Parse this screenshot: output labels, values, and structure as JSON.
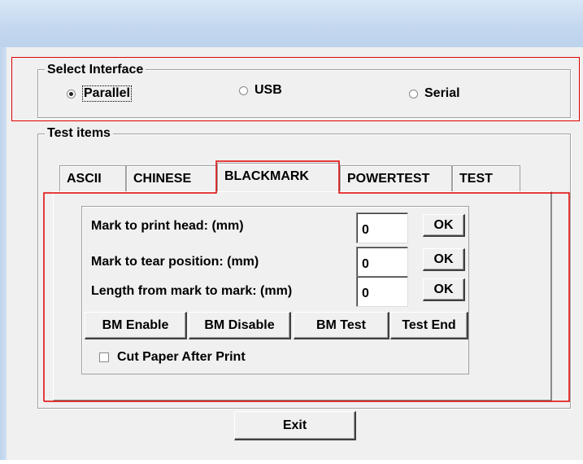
{
  "interface_group": {
    "legend": "Select Interface",
    "options": [
      {
        "label": "Parallel",
        "selected": true
      },
      {
        "label": "USB",
        "selected": false
      },
      {
        "label": "Serial",
        "selected": false
      }
    ]
  },
  "test_group": {
    "legend": "Test items",
    "tabs": [
      "ASCII",
      "CHINESE",
      "BLACKMARK",
      "POWERTEST",
      "TEST"
    ],
    "active_tab": "BLACKMARK"
  },
  "blackmark": {
    "rows": [
      {
        "label": "Mark to print head: (mm)",
        "value": "0",
        "ok": "OK"
      },
      {
        "label": "Mark to tear position: (mm)",
        "value": "0",
        "ok": "OK"
      },
      {
        "label": "Length from mark to mark: (mm)",
        "value": "0",
        "ok": "OK"
      }
    ],
    "buttons": [
      "BM Enable",
      "BM Disable",
      "BM Test",
      "Test End"
    ],
    "cut_paper_label": "Cut Paper After Print",
    "cut_paper_checked": false
  },
  "exit_label": "Exit",
  "colors": {
    "highlight": "#e00000",
    "face": "#f0f0f0",
    "titlebar": "#c3d7ee"
  }
}
